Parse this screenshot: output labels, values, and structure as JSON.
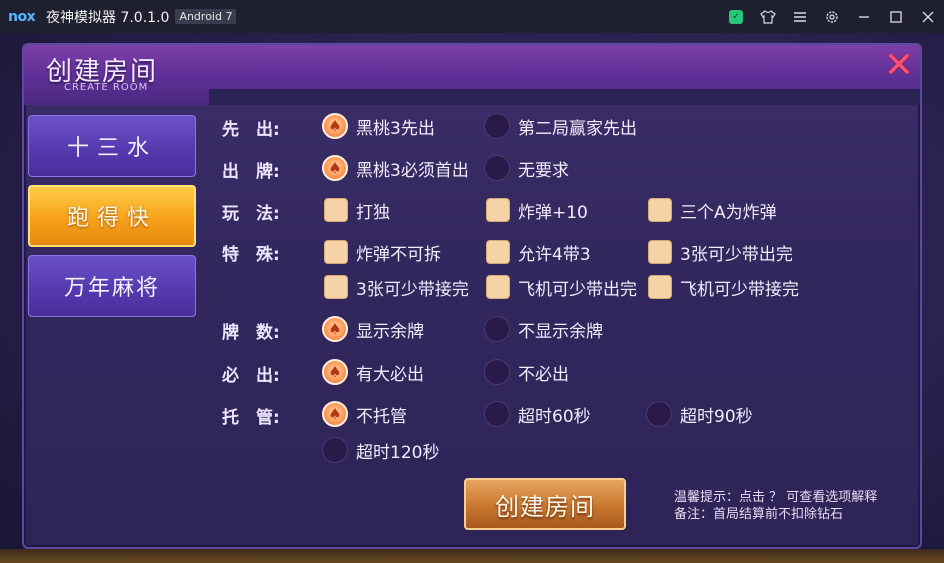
{
  "titlebar": {
    "logo": "nox",
    "title": "夜神模拟器 7.0.1.0",
    "android_badge": "Android 7",
    "icons": [
      "store-icon",
      "shirt-icon",
      "menu-icon",
      "settings-icon",
      "minimize-icon",
      "maximize-icon",
      "close-icon"
    ]
  },
  "dialog": {
    "title": "创建房间",
    "subtitle": "CREATE ROOM",
    "close_label": "✕"
  },
  "tabs": [
    {
      "label": "十三水",
      "active": false
    },
    {
      "label": "跑得快",
      "active": true
    },
    {
      "label": "万年麻将",
      "active": false
    }
  ],
  "rows": {
    "first": {
      "label": "先　出:",
      "options": [
        {
          "text": "黑桃3先出",
          "checked": true
        },
        {
          "text": "第二局赢家先出",
          "checked": false
        }
      ]
    },
    "play": {
      "label": "出　牌:",
      "options": [
        {
          "text": "黑桃3必须首出",
          "checked": true
        },
        {
          "text": "无要求",
          "checked": false
        }
      ]
    },
    "rules": {
      "label": "玩　法:",
      "options": [
        {
          "text": "打独"
        },
        {
          "text": "炸弹+10"
        },
        {
          "text": "三个A为炸弹"
        }
      ]
    },
    "special": {
      "label": "特　殊:",
      "options": [
        {
          "text": "炸弹不可拆"
        },
        {
          "text": "允许4带3"
        },
        {
          "text": "3张可少带出完"
        },
        {
          "text": "3张可少带接完"
        },
        {
          "text": "飞机可少带出完"
        },
        {
          "text": "飞机可少带接完"
        }
      ]
    },
    "count": {
      "label": "牌　数:",
      "options": [
        {
          "text": "显示余牌",
          "checked": true
        },
        {
          "text": "不显示余牌",
          "checked": false
        }
      ]
    },
    "must": {
      "label": "必　出:",
      "options": [
        {
          "text": "有大必出",
          "checked": true
        },
        {
          "text": "不必出",
          "checked": false
        }
      ]
    },
    "trustee": {
      "label": "托　管:",
      "options": [
        {
          "text": "不托管",
          "checked": true
        },
        {
          "text": "超时60秒",
          "checked": false
        },
        {
          "text": "超时90秒",
          "checked": false
        },
        {
          "text": "超时120秒",
          "checked": false
        }
      ]
    }
  },
  "create_button": "创建房间",
  "tips": {
    "line1": "温馨提示：点击 ？ 可查看选项解释",
    "line2": "备注：首局结算前不扣除钻石"
  },
  "colors": {
    "panel": "#33285e",
    "active_tab": "#f7a21a",
    "radio_on": "#ff9c5c",
    "checkbox": "#f6d3a6",
    "close": "#ff4f72"
  }
}
